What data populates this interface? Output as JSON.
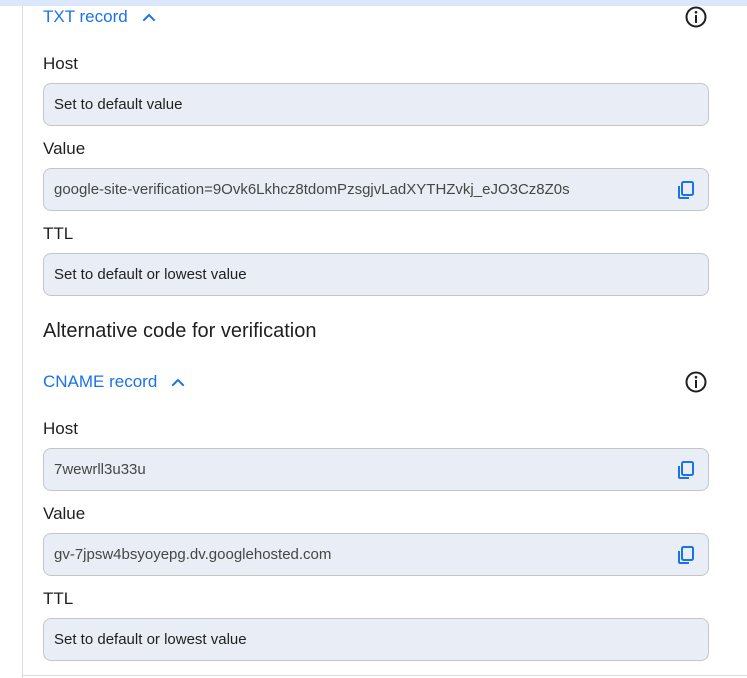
{
  "txt_record": {
    "title": "TXT record",
    "host_label": "Host",
    "host_value": "Set to default value",
    "value_label": "Value",
    "value_value": "google-site-verification=9Ovk6Lkhcz8tdomPzsgjvLadXYTHZvkj_eJO3Cz8Z0s",
    "ttl_label": "TTL",
    "ttl_value": "Set to default or lowest value",
    "info_icon": "info-icon",
    "copy_icon": "copy-icon"
  },
  "alternative": {
    "title": "Alternative code for verification"
  },
  "cname_record": {
    "title": "CNAME record",
    "host_label": "Host",
    "host_value": "7wewrll3u33u",
    "value_label": "Value",
    "value_value": "gv-7jpsw4bsyoyepg.dv.googlehosted.com",
    "ttl_label": "TTL",
    "ttl_value": "Set to default or lowest value",
    "info_icon": "info-icon",
    "copy_icon": "copy-icon"
  },
  "colors": {
    "accent": "#1a73e8",
    "field_background": "#e9eef6",
    "field_border": "#c4c7c5",
    "text": "#1f1f1f",
    "top_strip": "#dbe7fb"
  }
}
